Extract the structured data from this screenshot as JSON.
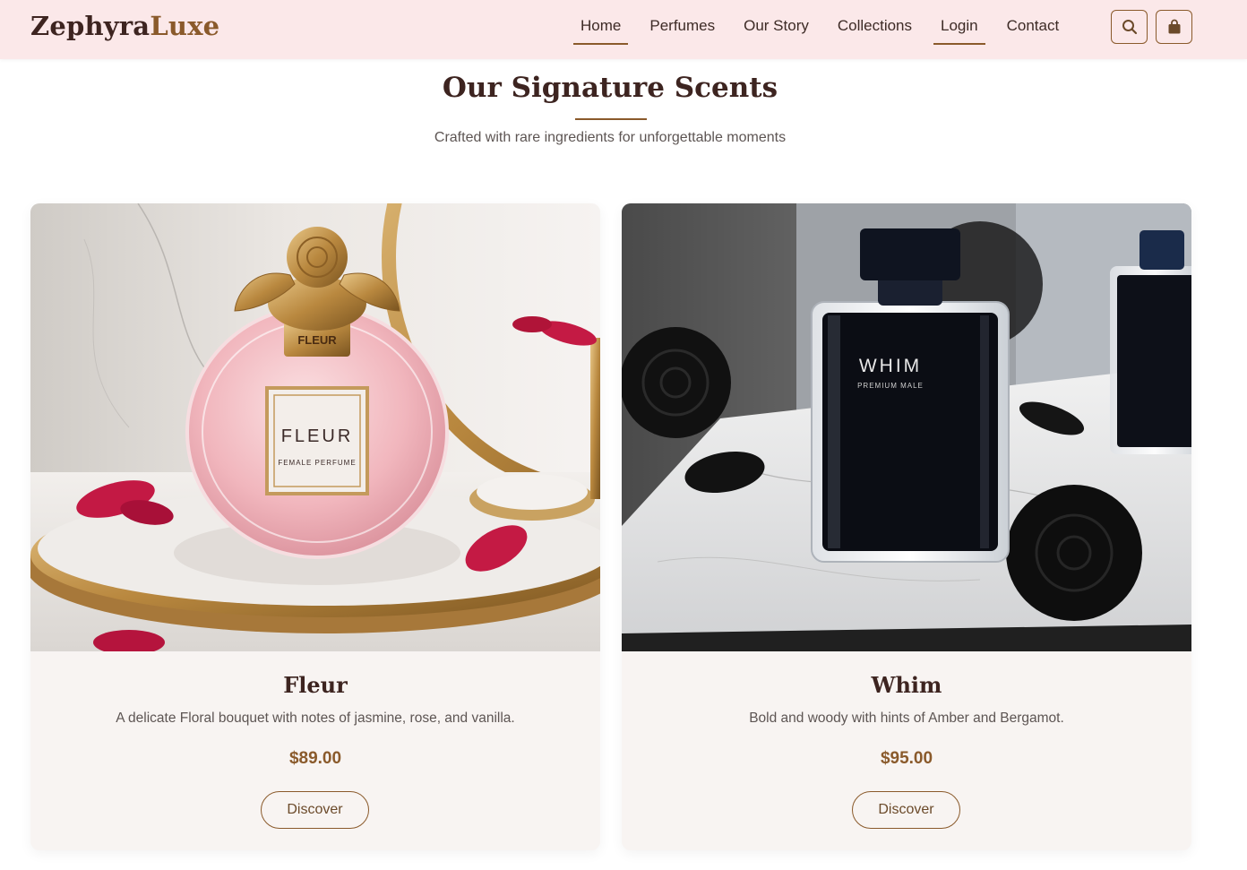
{
  "brand": {
    "name_part1": "Zephyra",
    "name_part2": "Luxe"
  },
  "nav": {
    "items": [
      {
        "label": "Home"
      },
      {
        "label": "Perfumes"
      },
      {
        "label": "Our Story"
      },
      {
        "label": "Collections"
      },
      {
        "label": "Login"
      },
      {
        "label": "Contact"
      }
    ],
    "icons": [
      "search-icon",
      "shopping-bag-icon"
    ]
  },
  "section": {
    "title": "Our Signature Scents",
    "subtitle": "Crafted with rare ingredients for unforgettable moments"
  },
  "products": [
    {
      "name": "Fleur",
      "description": "A delicate Floral bouquet with notes of jasmine, rose, and vanilla.",
      "price": "$89.00",
      "button_label": "Discover",
      "image_label": "FLEUR",
      "image_sublabel": "FEMALE PERFUME"
    },
    {
      "name": "Whim",
      "description": "Bold and woody with hints of Amber and Bergamot.",
      "price": "$95.00",
      "button_label": "Discover",
      "image_label": "WHIM",
      "image_sublabel": "PREMIUM MALE"
    }
  ],
  "colors": {
    "nav_bg": "#fbe8e9",
    "accent": "#8a5a2b",
    "dark_text": "#3d2420",
    "card_bg": "#f8f4f2"
  }
}
